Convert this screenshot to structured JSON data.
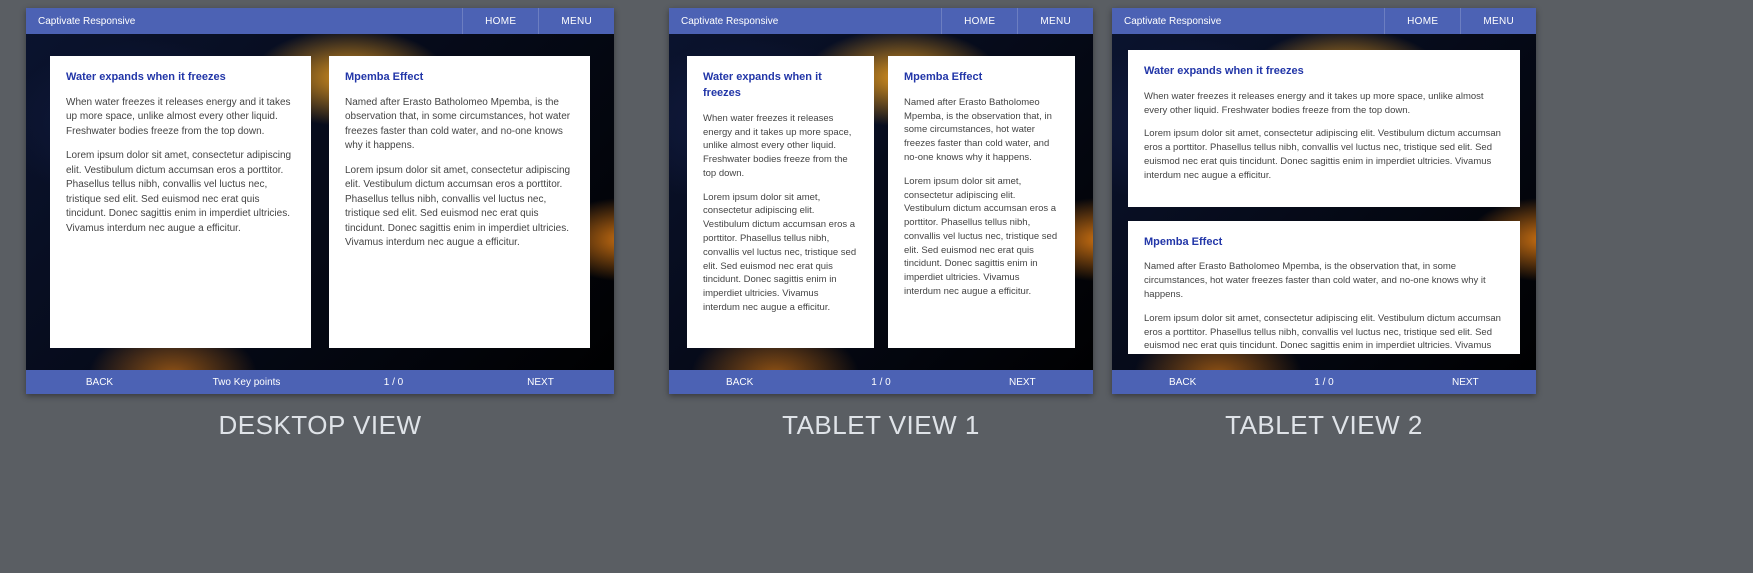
{
  "app": {
    "brand": "Captivate Responsive",
    "nav": {
      "home": "HOME",
      "menu": "MENU"
    }
  },
  "cards": {
    "water": {
      "title": "Water expands when it freezes",
      "p1": "When water freezes it releases energy and it takes up more space,  unlike almost every other liquid. Freshwater bodies freeze from the top down.",
      "p2": "Lorem ipsum dolor sit amet, consectetur adipiscing elit. Vestibulum dictum accumsan eros a porttitor. Phasellus tellus nibh, convallis vel luctus nec, tristique sed elit. Sed euismod nec erat quis tincidunt. Donec sagittis enim in imperdiet ultricies. Vivamus interdum nec augue a efficitur."
    },
    "mpemba": {
      "title": "Mpemba Effect",
      "p1": "Named after Erasto Batholomeo Mpemba, is the observation that, in some circumstances, hot water freezes faster than cold water, and no-one knows why it happens.",
      "p2": "Lorem ipsum dolor sit amet, consectetur adipiscing elit. Vestibulum dictum accumsan eros a porttitor. Phasellus tellus nibh, convallis vel luctus nec, tristique sed elit. Sed euismod nec erat quis tincidunt. Donec sagittis enim in imperdiet ultricies. Vivamus interdum nec augue a efficitur."
    }
  },
  "footer": {
    "back": "BACK",
    "next": "NEXT",
    "subtitle": "Two Key points",
    "page": "1 / 0"
  },
  "labels": {
    "desktop": "DESKTOP VIEW",
    "tablet1": "TABLET VIEW 1",
    "tablet2": "TABLET VIEW 2"
  }
}
